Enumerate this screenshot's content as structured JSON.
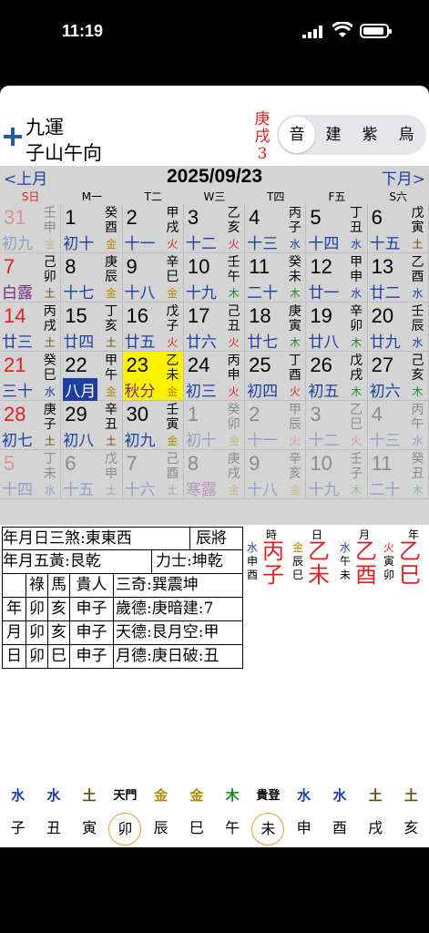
{
  "status": {
    "time": "11:19"
  },
  "header": {
    "line1": "九運",
    "line2": "子山午向",
    "red_gz": [
      "庚",
      "戌",
      "3"
    ],
    "segments": [
      {
        "label": "音",
        "active": true
      },
      {
        "label": "建",
        "active": false
      },
      {
        "label": "紫",
        "active": false
      },
      {
        "label": "烏",
        "active": false
      }
    ]
  },
  "calendar": {
    "prev_label": "<上月",
    "next_label": "下月>",
    "date_title": "2025/09/23",
    "weekdays": [
      "S日",
      "M一",
      "T二",
      "W三",
      "T四",
      "F五",
      "S六"
    ],
    "colors": {
      "red": "#e02020",
      "blue": "#1d3fa3",
      "purple": "#7a2a8a",
      "green": "#1a8a2a",
      "gold": "#b08a00",
      "today": "#fff200"
    },
    "weeks": [
      [
        {
          "d": "31",
          "l": "初九",
          "gz": "壬申",
          "e": "金",
          "dc": "red",
          "lc": "blue",
          "dim": true
        },
        {
          "d": "1",
          "l": "初十",
          "gz": "癸酉",
          "e": "金",
          "dc": "black",
          "lc": "blue"
        },
        {
          "d": "2",
          "l": "十一",
          "gz": "甲戌",
          "e": "火",
          "dc": "black",
          "lc": "blue"
        },
        {
          "d": "3",
          "l": "十二",
          "gz": "乙亥",
          "e": "火",
          "dc": "black",
          "lc": "blue"
        },
        {
          "d": "4",
          "l": "十三",
          "gz": "丙子",
          "e": "水",
          "dc": "black",
          "lc": "blue"
        },
        {
          "d": "5",
          "l": "十四",
          "gz": "丁丑",
          "e": "水",
          "dc": "black",
          "lc": "blue"
        },
        {
          "d": "6",
          "l": "十五",
          "gz": "戊寅",
          "e": "土",
          "dc": "black",
          "lc": "blue"
        }
      ],
      [
        {
          "d": "7",
          "l": "白露",
          "gz": "己卯",
          "e": "土",
          "dc": "red",
          "lc": "purple"
        },
        {
          "d": "8",
          "l": "十七",
          "gz": "庚辰",
          "e": "金",
          "dc": "black",
          "lc": "blue"
        },
        {
          "d": "9",
          "l": "十八",
          "gz": "辛巳",
          "e": "金",
          "dc": "black",
          "lc": "blue"
        },
        {
          "d": "10",
          "l": "十九",
          "gz": "壬午",
          "e": "木",
          "dc": "black",
          "lc": "blue"
        },
        {
          "d": "11",
          "l": "二十",
          "gz": "癸未",
          "e": "木",
          "dc": "black",
          "lc": "blue"
        },
        {
          "d": "12",
          "l": "廿一",
          "gz": "甲申",
          "e": "水",
          "dc": "black",
          "lc": "blue"
        },
        {
          "d": "13",
          "l": "廿二",
          "gz": "乙酉",
          "e": "水",
          "dc": "black",
          "lc": "blue"
        }
      ],
      [
        {
          "d": "14",
          "l": "廿三",
          "gz": "丙戌",
          "e": "土",
          "dc": "red",
          "lc": "blue"
        },
        {
          "d": "15",
          "l": "廿四",
          "gz": "丁亥",
          "e": "土",
          "dc": "black",
          "lc": "blue"
        },
        {
          "d": "16",
          "l": "廿五",
          "gz": "戊子",
          "e": "火",
          "dc": "black",
          "lc": "blue"
        },
        {
          "d": "17",
          "l": "廿六",
          "gz": "己丑",
          "e": "火",
          "dc": "black",
          "lc": "blue"
        },
        {
          "d": "18",
          "l": "廿七",
          "gz": "庚寅",
          "e": "木",
          "dc": "black",
          "lc": "blue"
        },
        {
          "d": "19",
          "l": "廿八",
          "gz": "辛卯",
          "e": "木",
          "dc": "black",
          "lc": "blue"
        },
        {
          "d": "20",
          "l": "廿九",
          "gz": "壬辰",
          "e": "水",
          "dc": "black",
          "lc": "blue"
        }
      ],
      [
        {
          "d": "21",
          "l": "三十",
          "gz": "癸巳",
          "e": "水",
          "dc": "red",
          "lc": "blue"
        },
        {
          "d": "22",
          "l": "八月",
          "gz": "甲午",
          "e": "金",
          "dc": "black",
          "lc": "month"
        },
        {
          "d": "23",
          "l": "秋分",
          "gz": "乙未",
          "e": "金",
          "dc": "black",
          "lc": "purple",
          "today": true
        },
        {
          "d": "24",
          "l": "初三",
          "gz": "丙申",
          "e": "火",
          "dc": "black",
          "lc": "blue"
        },
        {
          "d": "25",
          "l": "初四",
          "gz": "丁酉",
          "e": "火",
          "dc": "black",
          "lc": "blue"
        },
        {
          "d": "26",
          "l": "初五",
          "gz": "戊戌",
          "e": "木",
          "dc": "black",
          "lc": "blue"
        },
        {
          "d": "27",
          "l": "初六",
          "gz": "己亥",
          "e": "木",
          "dc": "black",
          "lc": "blue"
        }
      ],
      [
        {
          "d": "28",
          "l": "初七",
          "gz": "庚子",
          "e": "土",
          "dc": "red",
          "lc": "blue"
        },
        {
          "d": "29",
          "l": "初八",
          "gz": "辛丑",
          "e": "土",
          "dc": "black",
          "lc": "blue"
        },
        {
          "d": "30",
          "l": "初九",
          "gz": "壬寅",
          "e": "金",
          "dc": "black",
          "lc": "blue"
        },
        {
          "d": "1",
          "l": "初十",
          "gz": "癸卯",
          "e": "金",
          "dc": "black",
          "lc": "blue",
          "dim": true
        },
        {
          "d": "2",
          "l": "十一",
          "gz": "甲辰",
          "e": "火",
          "dc": "black",
          "lc": "blue",
          "dim": true
        },
        {
          "d": "3",
          "l": "十二",
          "gz": "乙巳",
          "e": "火",
          "dc": "black",
          "lc": "blue",
          "dim": true
        },
        {
          "d": "4",
          "l": "十三",
          "gz": "丙午",
          "e": "水",
          "dc": "black",
          "lc": "blue",
          "dim": true
        }
      ],
      [
        {
          "d": "5",
          "l": "十四",
          "gz": "丁未",
          "e": "水",
          "dc": "red",
          "lc": "blue",
          "dim": true
        },
        {
          "d": "6",
          "l": "十五",
          "gz": "戊申",
          "e": "土",
          "dc": "black",
          "lc": "blue",
          "dim": true
        },
        {
          "d": "7",
          "l": "十六",
          "gz": "己酉",
          "e": "土",
          "dc": "black",
          "lc": "blue",
          "dim": true
        },
        {
          "d": "8",
          "l": "寒露",
          "gz": "庚戌",
          "e": "金",
          "dc": "black",
          "lc": "purple",
          "dim": true
        },
        {
          "d": "9",
          "l": "十八",
          "gz": "辛亥",
          "e": "金",
          "dc": "black",
          "lc": "blue",
          "dim": true
        },
        {
          "d": "10",
          "l": "十九",
          "gz": "壬子",
          "e": "木",
          "dc": "black",
          "lc": "blue",
          "dim": true
        },
        {
          "d": "11",
          "l": "二十",
          "gz": "癸丑",
          "e": "木",
          "dc": "black",
          "lc": "blue",
          "dim": true
        }
      ]
    ]
  },
  "info_table": {
    "r1": [
      "年月日三煞:東東西",
      "辰將"
    ],
    "r2": [
      "年月五黃:艮乾",
      "力士:坤乾"
    ],
    "r3": [
      "祿",
      "馬",
      "貴人",
      "三奇:巽震坤"
    ],
    "r4": [
      "年",
      "卯",
      "亥",
      "申子",
      "歲德:庚暗建:7"
    ],
    "r5": [
      "月",
      "卯",
      "亥",
      "申子",
      "天德:艮月空:甲"
    ],
    "r6": [
      "日",
      "卯",
      "巳",
      "申子",
      "月德:庚日破:丑"
    ]
  },
  "pillars": {
    "headers": [
      "時",
      "日",
      "月",
      "年"
    ],
    "items": [
      {
        "side": [
          "水",
          "申",
          "酉"
        ],
        "side_color": "blue",
        "stem": "丙",
        "branch": "子"
      },
      {
        "side": [
          "金",
          "辰",
          "巳"
        ],
        "side_color": "gold",
        "stem": "乙",
        "branch": "未"
      },
      {
        "side": [
          "水",
          "午",
          "未"
        ],
        "side_color": "blue",
        "stem": "乙",
        "branch": "酉"
      },
      {
        "side": [
          "火",
          "寅",
          "卯"
        ],
        "side_color": "red",
        "stem": "乙",
        "branch": "巳"
      }
    ]
  },
  "bottom": {
    "elements": [
      {
        "t": "水",
        "c": "blue"
      },
      {
        "t": "水",
        "c": "blue"
      },
      {
        "t": "土",
        "c": "brown"
      },
      {
        "t": "天門",
        "c": "black"
      },
      {
        "t": "金",
        "c": "gold"
      },
      {
        "t": "金",
        "c": "gold"
      },
      {
        "t": "木",
        "c": "green"
      },
      {
        "t": "貴登",
        "c": "black"
      },
      {
        "t": "水",
        "c": "blue"
      },
      {
        "t": "水",
        "c": "blue"
      },
      {
        "t": "土",
        "c": "brown"
      },
      {
        "t": "土",
        "c": "brown"
      }
    ],
    "branches": [
      {
        "t": "子"
      },
      {
        "t": "丑"
      },
      {
        "t": "寅"
      },
      {
        "t": "卯",
        "circle": true
      },
      {
        "t": "辰"
      },
      {
        "t": "巳"
      },
      {
        "t": "午"
      },
      {
        "t": "未",
        "circle": true
      },
      {
        "t": "申"
      },
      {
        "t": "酉"
      },
      {
        "t": "戌"
      },
      {
        "t": "亥"
      }
    ]
  }
}
